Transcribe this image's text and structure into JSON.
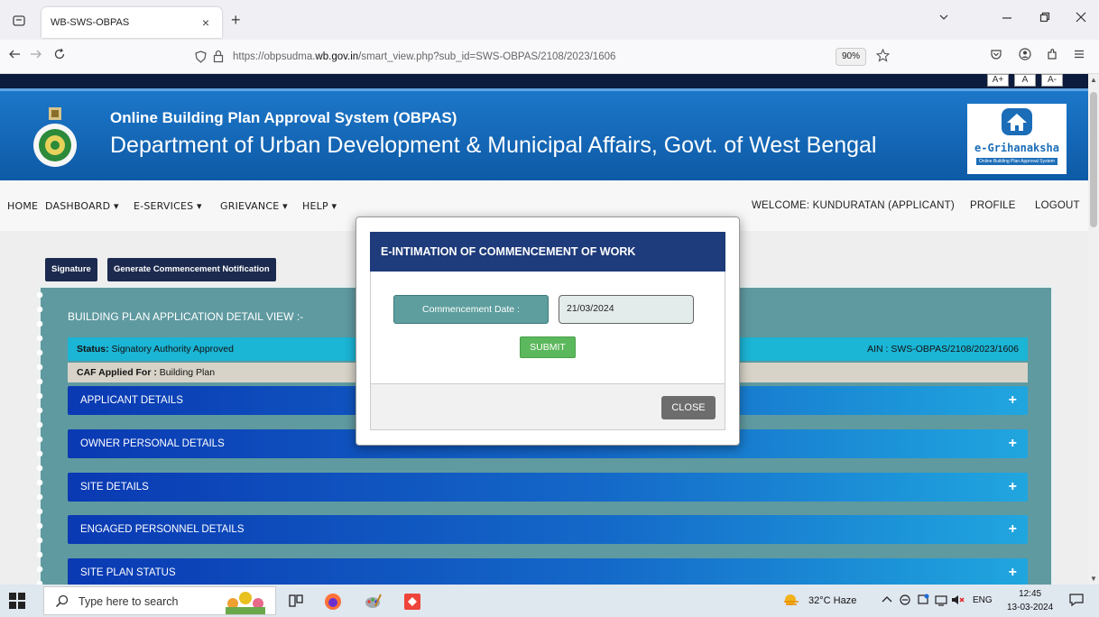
{
  "browser": {
    "tab_title": "WB-SWS-OBPAS",
    "tab_close": "×",
    "new_tab": "+",
    "url_prefix": "https://obpsudma.",
    "url_domain": "wb.gov.in",
    "url_rest": "/smart_view.php?sub_id=SWS-OBPAS/2108/2023/1606",
    "zoom": "90%",
    "icons": [
      "tab-list-icon",
      "back-icon",
      "forward-icon",
      "reload-icon",
      "shield-icon",
      "lock-icon",
      "star-icon",
      "pocket-icon",
      "account-icon",
      "extensions-icon",
      "menu-icon",
      "minimize-icon",
      "restore-icon",
      "close-icon",
      "chevron-down-icon"
    ]
  },
  "font_controls": [
    "A+",
    "A",
    "A-"
  ],
  "header": {
    "title": "Online Building Plan Approval System (OBPAS)",
    "subtitle": "Department of Urban Development & Municipal Affairs, Govt. of West Bengal",
    "logo_text": "e-Grihanaksha",
    "logo_tagline": "Online Building Plan Approval System"
  },
  "menu": {
    "home": "HOME",
    "dashboard": "DASHBOARD ▾",
    "eservices": "E-SERVICES ▾",
    "grievance": "GRIEVANCE ▾",
    "help": "HELP ▾",
    "welcome": "WELCOME: KUNDURATAN (APPLICANT)",
    "profile": "PROFILE",
    "logout": "LOGOUT"
  },
  "actions": {
    "signature": "Signature",
    "generate": "Generate Commencement Notification"
  },
  "detail": {
    "heading": "BUILDING PLAN APPLICATION DETAIL VIEW :-",
    "status_label": "Status:",
    "status_value": " Signatory Authority Approved",
    "ain": "AIN : SWS-OBPAS/2108/2023/1606",
    "caf_label": "CAF Applied For :",
    "caf_value": " Building Plan",
    "sections": [
      {
        "label": "APPLICANT DETAILS",
        "icon": "+"
      },
      {
        "label": "OWNER PERSONAL DETAILS",
        "icon": "+"
      },
      {
        "label": "SITE DETAILS",
        "icon": "+"
      },
      {
        "label": "ENGAGED PERSONNEL DETAILS",
        "icon": "+"
      },
      {
        "label": "SITE PLAN STATUS",
        "icon": "+"
      }
    ]
  },
  "modal": {
    "title": "E-INTIMATION OF COMMENCEMENT OF WORK",
    "date_label": "Commencement Date :",
    "date_value": "21/03/2024",
    "submit": "SUBMIT",
    "close": "CLOSE"
  },
  "taskbar": {
    "search_placeholder": "Type here to search",
    "weather": "32°C  Haze",
    "lang": "ENG",
    "time": "12:45",
    "date": "13-03-2024"
  },
  "colors": {
    "header_blue": "#0d5aa6",
    "modal_head": "#1e3b7b",
    "submit_green": "#5cb85c",
    "status_cyan": "#1bb5d6",
    "panel_teal": "#5f9aa0"
  }
}
